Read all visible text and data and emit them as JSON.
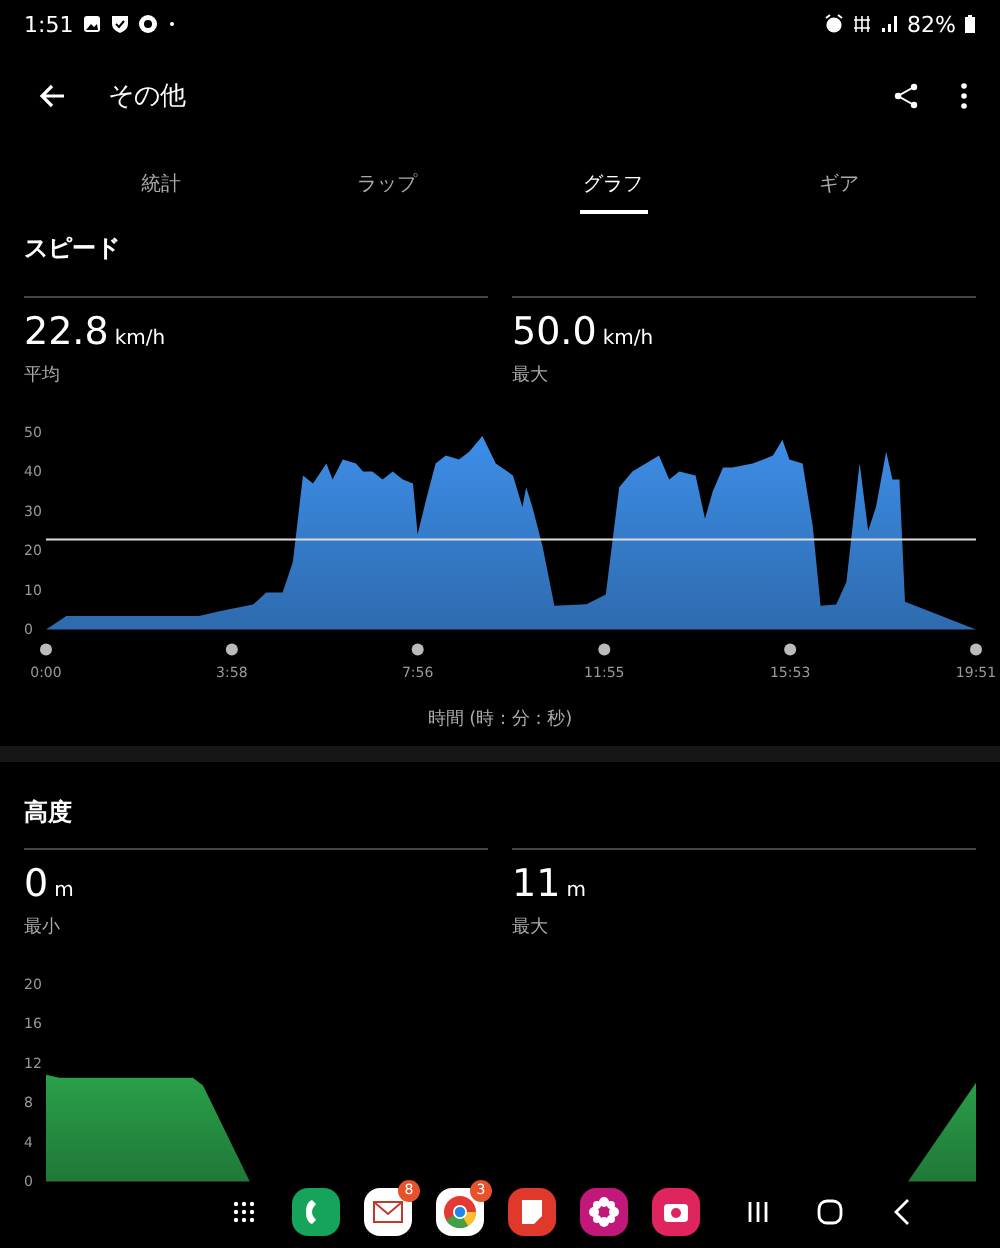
{
  "status_bar": {
    "time": "1:51",
    "battery": "82%"
  },
  "app_bar": {
    "title": "その他"
  },
  "tabs": [
    {
      "label": "統計",
      "selected": false
    },
    {
      "label": "ラップ",
      "selected": false
    },
    {
      "label": "グラフ",
      "selected": true
    },
    {
      "label": "ギア",
      "selected": false
    }
  ],
  "sections": [
    {
      "title": "スピード",
      "stats": [
        {
          "value": "22.8",
          "unit": "km/h",
          "label": "平均"
        },
        {
          "value": "50.0",
          "unit": "km/h",
          "label": "最大"
        }
      ],
      "chart_data": {
        "type": "area",
        "xlabel": "時間 (時 : 分 : 秒)",
        "x": [
          0,
          26,
          196,
          222,
          265,
          282,
          303,
          316,
          329,
          342,
          359,
          367,
          380,
          397,
          406,
          418,
          431,
          444,
          457,
          470,
          476,
          487,
          499,
          512,
          529,
          542,
          559,
          576,
          598,
          610,
          615,
          623,
          636,
          651,
          692,
          717,
          734,
          751,
          785,
          798,
          811,
          832,
          844,
          854,
          867,
          879,
          905,
          931,
          943,
          952,
          969,
          982,
          992,
          1012,
          1025,
          1042,
          1053,
          1063,
          1076,
          1084,
          1093,
          1100,
          1191
        ],
        "series": [
          {
            "color": "#3d8ee8",
            "values": [
              0,
              3.4,
              3.4,
              4.6,
              6.3,
              9.3,
              9.3,
              17,
              39,
              37,
              42,
              38,
              43,
              42,
              40,
              40,
              38,
              40,
              38,
              37,
              24,
              33,
              42,
              44,
              43,
              45,
              49,
              42,
              39,
              31,
              36,
              31,
              21,
              6,
              6.4,
              8.8,
              36,
              40,
              44,
              38,
              40,
              39,
              28,
              35,
              41,
              41,
              42,
              44,
              48,
              43,
              42,
              26,
              6,
              6.3,
              12,
              42,
              25,
              31,
              45,
              38,
              38,
              7,
              0
            ]
          }
        ],
        "xlim": [
          0,
          1191
        ],
        "ylim": [
          0,
          50
        ],
        "xticks": [
          {
            "value": 0,
            "label": "0:00"
          },
          {
            "value": 238,
            "label": "3:58"
          },
          {
            "value": 476,
            "label": "7:56"
          },
          {
            "value": 715,
            "label": "11:55"
          },
          {
            "value": 953,
            "label": "15:53"
          },
          {
            "value": 1191,
            "label": "19:51"
          }
        ],
        "yticks": [
          0,
          10,
          20,
          30,
          40,
          50
        ],
        "ref_lines": [
          {
            "axis": "y",
            "value": 22.8
          }
        ]
      }
    },
    {
      "title": "高度",
      "stats": [
        {
          "value": "0",
          "unit": "m",
          "label": "最小"
        },
        {
          "value": "11",
          "unit": "m",
          "label": "最大"
        }
      ],
      "chart_data": {
        "type": "area",
        "x": [
          0,
          17,
          188,
          201,
          261,
          1104,
          1191
        ],
        "series": [
          {
            "color": "#2aa04a",
            "values": [
              10.8,
              10.5,
              10.5,
              9.7,
              0,
              0,
              10
            ]
          }
        ],
        "xlim": [
          0,
          1191
        ],
        "ylim": [
          0,
          20
        ],
        "yticks": [
          0,
          4,
          8,
          12,
          16,
          20
        ]
      }
    }
  ],
  "dock": {
    "badges": [
      "8",
      "3"
    ]
  }
}
